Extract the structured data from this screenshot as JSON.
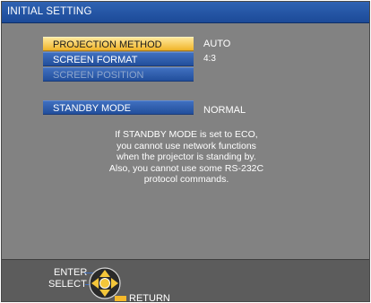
{
  "title": "INITIAL SETTING",
  "menu": [
    {
      "label": "PROJECTION METHOD",
      "value": "AUTO",
      "state": "selected"
    },
    {
      "label": "SCREEN FORMAT",
      "value": "4:3",
      "state": "normal"
    },
    {
      "label": "SCREEN POSITION",
      "value": "",
      "state": "disabled"
    },
    {
      "label": "STANDBY MODE",
      "value": "NORMAL",
      "state": "normal"
    }
  ],
  "note_lines": [
    "If STANDBY MODE is set to ECO,",
    "you cannot use network functions",
    "when the projector is standing by.",
    "Also, you cannot use some RS-232C",
    "protocol commands."
  ],
  "footer": {
    "enter_label": "ENTER",
    "select_label": "SELECT",
    "return_label": "RETURN"
  },
  "colors": {
    "title_bar": "#1c4a98",
    "selected_item": "#f0b52a",
    "menu_item": "#224f9c",
    "background": "#828282"
  },
  "icons": [
    "dpad-icon",
    "return-button-icon"
  ]
}
